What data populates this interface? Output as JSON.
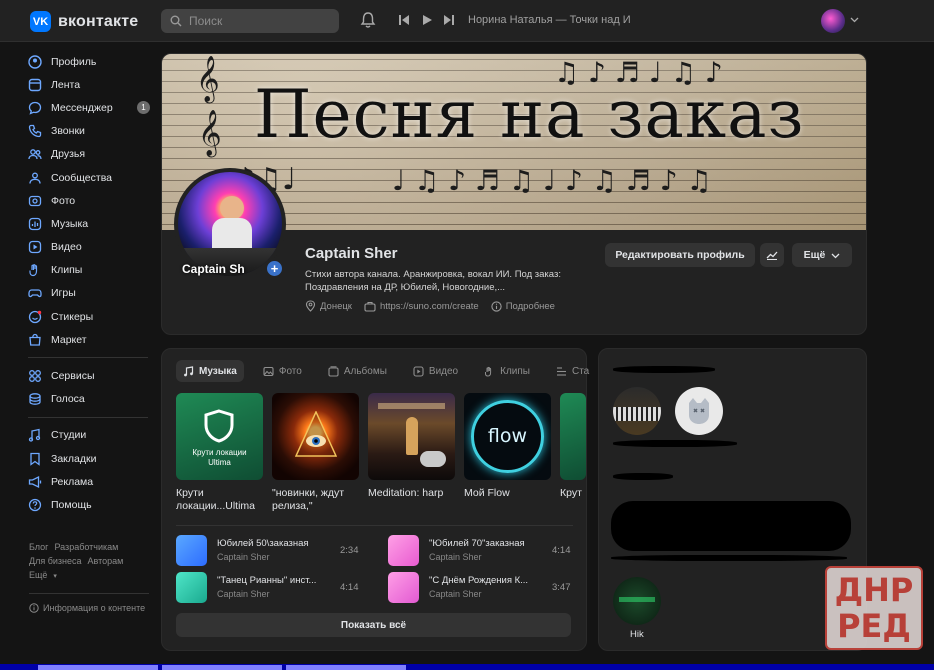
{
  "header": {
    "logo_mark": "VK",
    "logo_text": "вконтакте",
    "search_placeholder": "Поиск",
    "now_playing": "Норина Наталья — Точки над И"
  },
  "sidebar": {
    "items": [
      {
        "label": "Профиль",
        "icon": "user-circle-icon"
      },
      {
        "label": "Лента",
        "icon": "feed-icon"
      },
      {
        "label": "Мессенджер",
        "icon": "chat-icon",
        "badge": "1"
      },
      {
        "label": "Звонки",
        "icon": "phone-icon"
      },
      {
        "label": "Друзья",
        "icon": "friends-icon"
      },
      {
        "label": "Сообщества",
        "icon": "communities-icon"
      },
      {
        "label": "Фото",
        "icon": "photo-icon"
      },
      {
        "label": "Музыка",
        "icon": "music-icon"
      },
      {
        "label": "Видео",
        "icon": "video-icon"
      },
      {
        "label": "Клипы",
        "icon": "clips-icon"
      },
      {
        "label": "Игры",
        "icon": "gamepad-icon"
      },
      {
        "label": "Стикеры",
        "icon": "sticker-icon"
      },
      {
        "label": "Маркет",
        "icon": "market-icon"
      }
    ],
    "items2": [
      {
        "label": "Сервисы",
        "icon": "services-icon"
      },
      {
        "label": "Голоса",
        "icon": "coins-icon"
      }
    ],
    "items3": [
      {
        "label": "Студии",
        "icon": "studio-icon"
      },
      {
        "label": "Закладки",
        "icon": "bookmark-icon"
      },
      {
        "label": "Реклама",
        "icon": "megaphone-icon"
      },
      {
        "label": "Помощь",
        "icon": "help-icon"
      }
    ],
    "footer": {
      "blog": "Блог",
      "developers": "Разработчикам",
      "business": "Для бизнеса",
      "authors": "Авторам",
      "more": "Ещё",
      "content_info": "Информация о контенте"
    }
  },
  "profile": {
    "cover_title": "Песня на заказ",
    "avatar_caption": "Captain Sh",
    "name": "Captain Sher",
    "status_line1": "Стихи автора канала. Аранжировка, вокал ИИ. Под заказ:",
    "status_line2": "Поздравления на ДР, Юбилей, Новогодние,...",
    "city": "Донецк",
    "site": "https://suno.com/create",
    "more_info": "Подробнее",
    "edit_button": "Редактировать профиль",
    "more_button": "Ещё"
  },
  "media": {
    "tabs": [
      "Музыка",
      "Фото",
      "Альбомы",
      "Видео",
      "Клипы",
      "Ста"
    ],
    "albums": [
      {
        "title": "Крути локации...Ultima",
        "cover_text": "Крути локации Ultima"
      },
      {
        "title": "\"новинки, ждут релиза,\"",
        "cover_text": ""
      },
      {
        "title": "Meditation: harp",
        "cover_text": ""
      },
      {
        "title": "Мой Flow",
        "cover_text": "flow"
      },
      {
        "title": "Крут",
        "cover_text": ""
      }
    ],
    "tracks": [
      {
        "title": "Юбилей 50\\заказная",
        "artist": "Captain Sher",
        "duration": "2:34",
        "color": "#3a8cff"
      },
      {
        "title": "\"Юбилей 70\"заказная",
        "artist": "Captain Sher",
        "duration": "4:14",
        "color": "#ff7bd6"
      },
      {
        "title": "\"Танец Рианны\" инст...",
        "artist": "Captain Sher",
        "duration": "4:14",
        "color": "#2ed3b8"
      },
      {
        "title": "\"С Днём Рождения К...",
        "artist": "Captain Sher",
        "duration": "3:47",
        "color": "#ff6ed0"
      }
    ],
    "show_all": "Показать всё"
  },
  "friends": {
    "last_name": "Hik"
  },
  "watermark": {
    "line1": "ДНР",
    "line2": "РЕД"
  }
}
